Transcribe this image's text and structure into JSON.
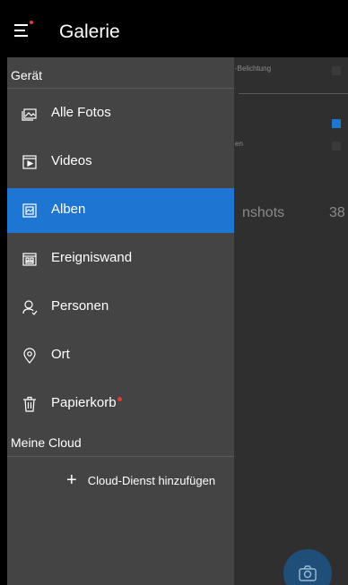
{
  "app": {
    "title": "Galerie"
  },
  "drawer": {
    "section_device": "Gerät",
    "items": [
      {
        "label": "Alle Fotos",
        "icon": "photos-icon"
      },
      {
        "label": "Videos",
        "icon": "video-icon"
      },
      {
        "label": "Alben",
        "icon": "album-icon",
        "selected": true
      },
      {
        "label": "Ereigniswand",
        "icon": "event-wall-icon"
      },
      {
        "label": "Personen",
        "icon": "person-icon"
      },
      {
        "label": "Ort",
        "icon": "location-pin-icon"
      },
      {
        "label": "Papierkorb",
        "icon": "trash-icon",
        "badge": true
      }
    ],
    "section_cloud": "Meine Cloud",
    "cloud_add_label": "Cloud-Dienst hinzufügen"
  },
  "background": {
    "setting_1": "-Belichtung",
    "setting_2": "en",
    "album_label": "nshots",
    "album_count": "38"
  },
  "colors": {
    "accent": "#1e76d2",
    "drawer_bg": "#444444",
    "badge": "#e53935"
  }
}
